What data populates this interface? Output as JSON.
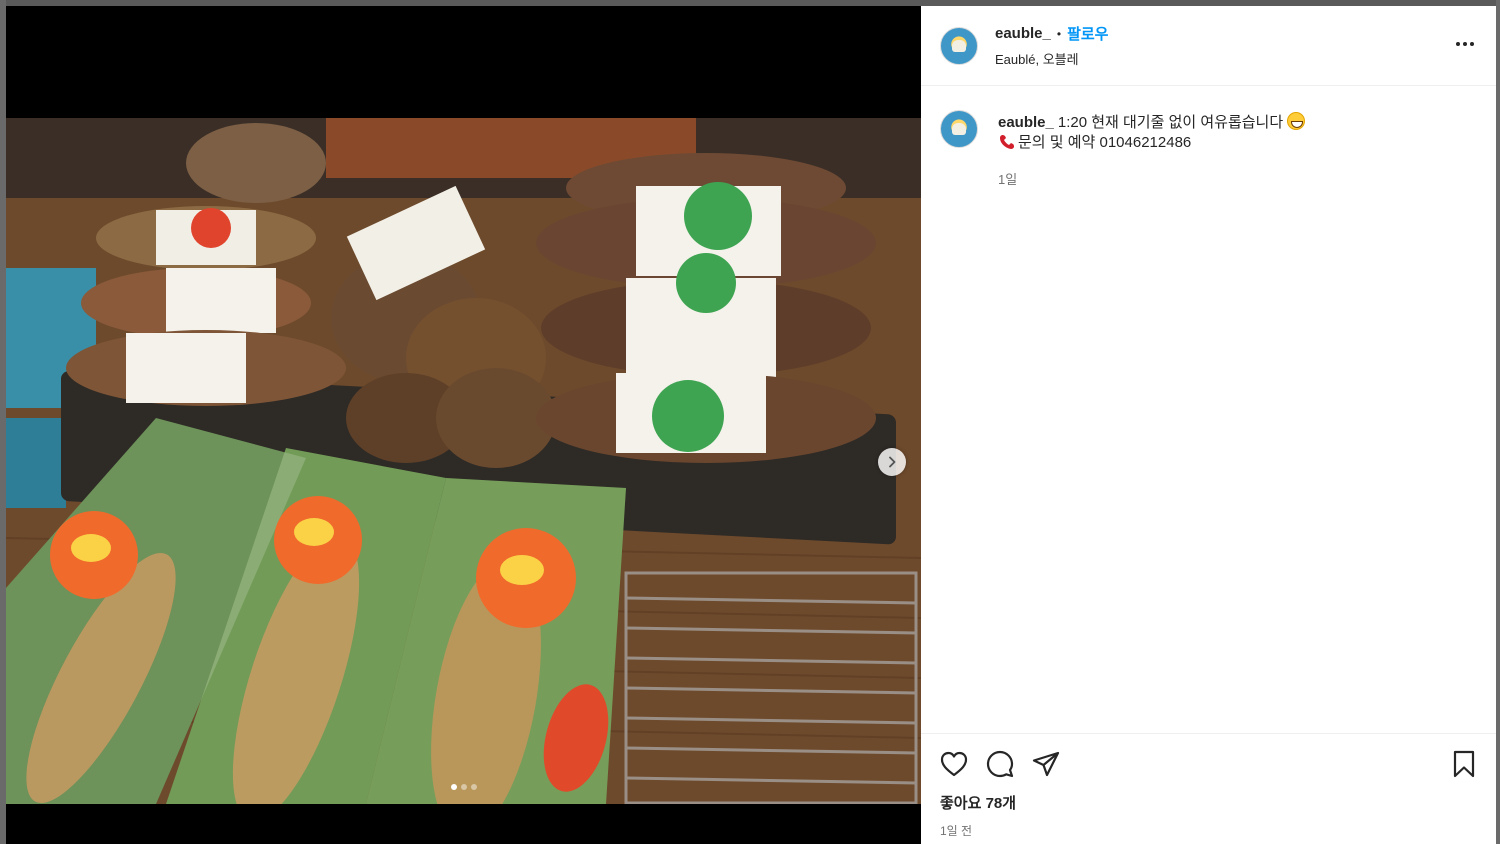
{
  "post": {
    "username": "eauble_",
    "separator": "•",
    "follow_label": "팔로우",
    "location": "Eaublé, 오블레",
    "more_icon": "more-horizontal-icon"
  },
  "media": {
    "image_alt": "포장된 샌드위치들",
    "next_icon": "chevron-right-icon",
    "carousel_count": 3,
    "carousel_index": 1
  },
  "caption": {
    "username": "eauble_",
    "line1": "1:20 현재 대기줄 없이 여유롭습니다",
    "line1_emoji": "grinning-face-emoji",
    "line2": "문의 및 예약 01046212486",
    "line2_emoji": "telephone-receiver-emoji",
    "time": "1일"
  },
  "actions": {
    "like_icon": "heart-icon",
    "comment_icon": "comment-icon",
    "share_icon": "send-icon",
    "save_icon": "bookmark-icon",
    "likes_text": "좋아요 78개",
    "time_text": "1일 전"
  },
  "colors": {
    "follow": "#0095f6",
    "text": "#262626",
    "muted": "#737373",
    "divider": "#efefef"
  }
}
